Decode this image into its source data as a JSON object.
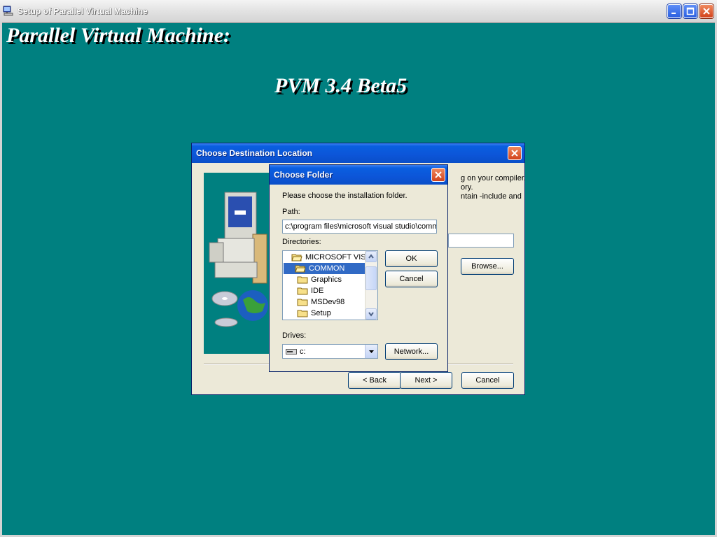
{
  "window": {
    "title": "Setup of Parallel Virtual Machine",
    "heading": "Parallel Virtual Machine:",
    "subheading": "PVM 3.4 Beta5"
  },
  "dest_dialog": {
    "title": "Choose Destination Location",
    "text_lines": [
      "g on your compiler.",
      "ory.",
      "ntain -include and"
    ],
    "browse_label": "Browse...",
    "back_label": "< Back",
    "next_label": "Next >",
    "cancel_label": "Cancel"
  },
  "folder_dialog": {
    "title": "Choose Folder",
    "instruction": "Please choose the installation folder.",
    "path_label": "Path:",
    "path_value": "c:\\program files\\microsoft visual studio\\common",
    "directories_label": "Directories:",
    "directories": [
      {
        "name": "MICROSOFT VISUAL STUDIO",
        "open": true,
        "selected": false
      },
      {
        "name": "COMMON",
        "open": true,
        "selected": true
      },
      {
        "name": "Graphics",
        "open": false,
        "selected": false
      },
      {
        "name": "IDE",
        "open": false,
        "selected": false
      },
      {
        "name": "MSDev98",
        "open": false,
        "selected": false
      },
      {
        "name": "Setup",
        "open": false,
        "selected": false
      }
    ],
    "drives_label": "Drives:",
    "drive_value": "c:",
    "ok_label": "OK",
    "cancel_label": "Cancel",
    "network_label": "Network..."
  },
  "colors": {
    "desktop": "#008080",
    "titlebar_blue": "#0a5fe0",
    "selection": "#316ac5"
  }
}
